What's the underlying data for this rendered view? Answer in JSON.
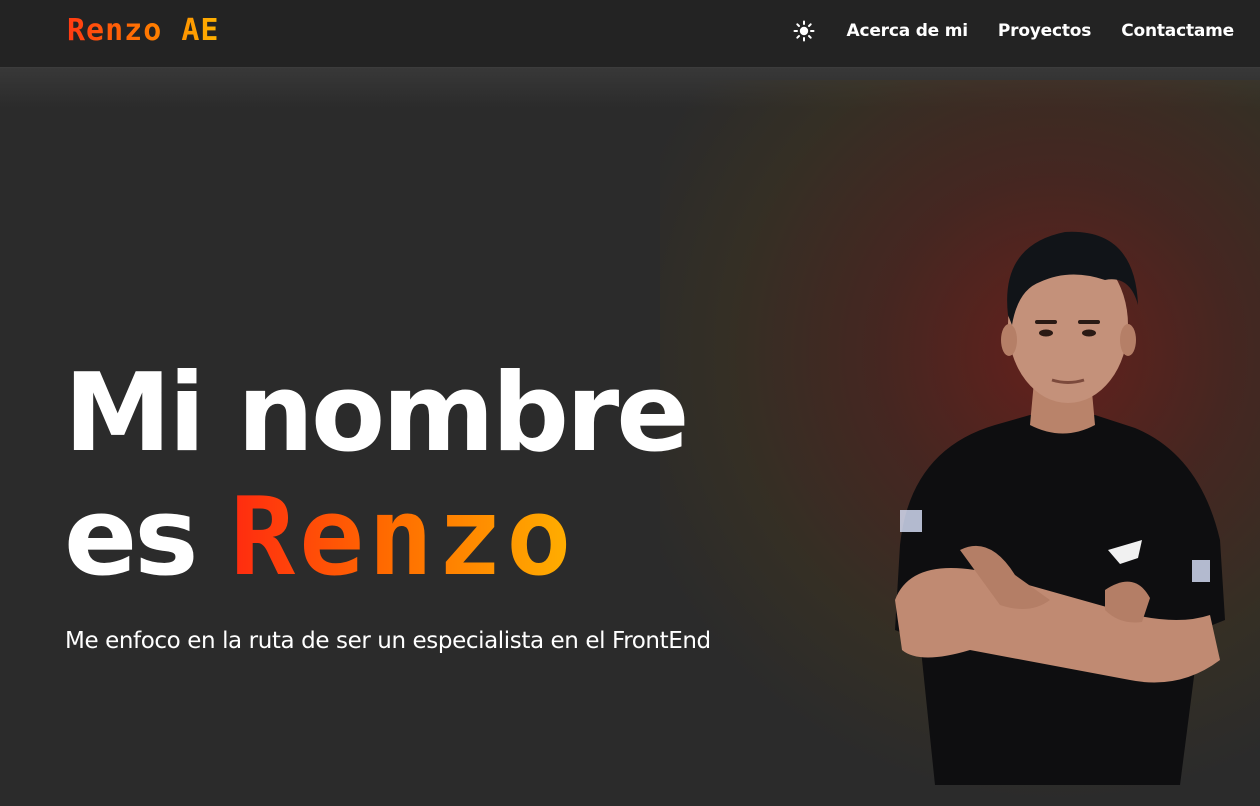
{
  "header": {
    "logo_text": "Renzo AE",
    "theme_toggle_icon": "sun-icon",
    "nav": [
      {
        "label": "Acerca de mi"
      },
      {
        "label": "Proyectos"
      },
      {
        "label": "Contactame"
      }
    ]
  },
  "hero": {
    "title_line1": "Mi nombre",
    "title_prefix": "es",
    "title_name": "Renzo",
    "subtitle": "Me enfoco en la ruta de ser un especialista en el FrontEnd",
    "portrait_icon": "portrait-photo"
  },
  "colors": {
    "background": "#2b2b2b",
    "navbar": "#232323",
    "accent_start": "#ff2a10",
    "accent_mid": "#ff6a00",
    "accent_end": "#ffb000",
    "text": "#ffffff"
  }
}
